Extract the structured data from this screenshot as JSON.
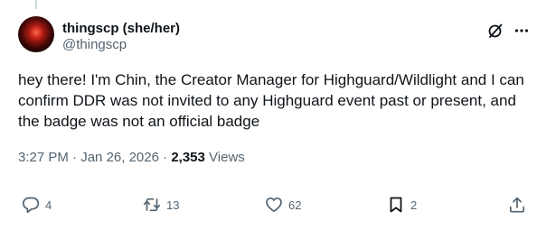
{
  "author": {
    "display_name": "thingscp (she/her)",
    "handle": "@thingscp"
  },
  "post": {
    "text": "hey there! I'm Chin, the Creator Manager for Highguard/Wildlight and I can confirm DDR was not invited to any Highguard event past or present, and the badge was not an official badge",
    "time": "3:27 PM",
    "date": "Jan 26, 2026",
    "views_count": "2,353",
    "views_label": "Views"
  },
  "actions": {
    "replies": "4",
    "reposts": "13",
    "likes": "62",
    "bookmarks": "2"
  },
  "icons": {
    "reply": "reply-icon",
    "repost": "repost-icon",
    "like": "heart-icon",
    "bookmark": "bookmark-icon",
    "share": "share-icon",
    "grok": "grok-icon",
    "more": "more-icon"
  },
  "colors": {
    "text": "#0f1419",
    "muted": "#536471"
  }
}
